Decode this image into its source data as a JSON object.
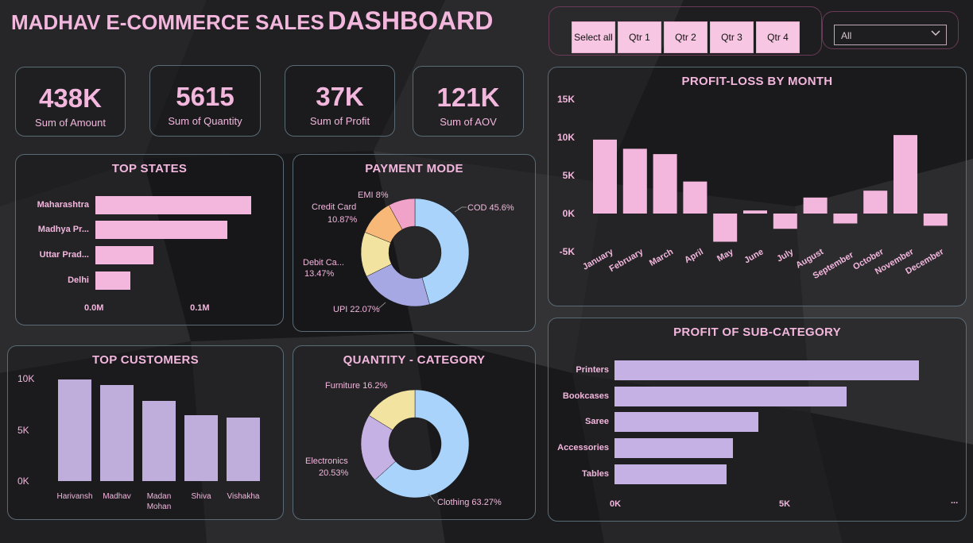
{
  "dashboard": {
    "title_part1": "MADHAV E-COMMERCE SALES",
    "title_part2": "DASHBOARD"
  },
  "slicer": {
    "buttons": [
      "Select all",
      "Qtr 1",
      "Qtr 2",
      "Qtr 3",
      "Qtr 4"
    ],
    "dropdown_value": "All"
  },
  "kpis": [
    {
      "value": "438K",
      "label": "Sum of Amount"
    },
    {
      "value": "5615",
      "label": "Sum of Quantity"
    },
    {
      "value": "37K",
      "label": "Sum of Profit"
    },
    {
      "value": "121K",
      "label": "Sum of AOV"
    }
  ],
  "colors": {
    "pink": "#f3b7de",
    "lavender": "#c6b1e4",
    "blue": "#a9d3fb",
    "yellow": "#f2e3a0",
    "orange": "#f8b878",
    "periwinkle": "#a5a8e2",
    "hotpink": "#f0a2c9"
  },
  "chart_data": [
    {
      "id": "top_states",
      "type": "bar",
      "orientation": "horizontal",
      "title": "TOP STATES",
      "categories": [
        "Maharashtra",
        "Madhya Pr...",
        "Uttar Prad...",
        "Delhi"
      ],
      "values": [
        0.147,
        0.125,
        0.055,
        0.033
      ],
      "x_ticks": [
        "0.0M",
        "0.1M"
      ],
      "xlim": [
        0,
        0.16
      ]
    },
    {
      "id": "payment_mode",
      "type": "pie",
      "donut": true,
      "title": "PAYMENT MODE",
      "labels": [
        "COD",
        "UPI",
        "Debit Ca...",
        "Credit Card",
        "EMI"
      ],
      "values": [
        45.6,
        22.07,
        13.47,
        10.87,
        8
      ],
      "label_texts": [
        "COD 45.6%",
        "UPI 22.07%",
        "Debit Ca... 13.47%",
        "Credit Card 10.87%",
        "EMI 8%"
      ],
      "colors": [
        "#a9d3fb",
        "#a5a8e2",
        "#f2e3a0",
        "#f8b878",
        "#f0a2c9"
      ]
    },
    {
      "id": "top_customers",
      "type": "bar",
      "title": "TOP CUSTOMERS",
      "categories": [
        "Harivansh",
        "Madhav",
        "Madan Mohan",
        "Shiva",
        "Vishakha"
      ],
      "values": [
        9900,
        9400,
        7800,
        6400,
        6200
      ],
      "y_ticks": [
        "10K",
        "5K",
        "0K"
      ],
      "ylim": [
        0,
        10000
      ]
    },
    {
      "id": "quantity_category",
      "type": "pie",
      "donut": true,
      "title": "QUANTITY - CATEGORY",
      "labels": [
        "Clothing",
        "Electronics",
        "Furniture"
      ],
      "values": [
        63.27,
        20.53,
        16.2
      ],
      "label_texts": [
        "Clothing 63.27%",
        "Electronics 20.53%",
        "Furniture 16.2%"
      ],
      "colors": [
        "#a9d3fb",
        "#c6b1e4",
        "#f2e3a0"
      ]
    },
    {
      "id": "profit_loss_month",
      "type": "bar",
      "title": "PROFIT-LOSS BY MONTH",
      "categories": [
        "January",
        "February",
        "March",
        "April",
        "May",
        "June",
        "July",
        "August",
        "September",
        "October",
        "November",
        "December"
      ],
      "values": [
        9700,
        8500,
        7800,
        4200,
        -3700,
        400,
        -2000,
        2100,
        -1300,
        3000,
        10300,
        -1600
      ],
      "y_ticks": [
        "15K",
        "10K",
        "5K",
        "0K",
        "-5K"
      ],
      "ylim": [
        -5000,
        15000
      ]
    },
    {
      "id": "profit_subcategory",
      "type": "bar",
      "orientation": "horizontal",
      "title": "PROFIT OF SUB-CATEGORY",
      "categories": [
        "Printers",
        "Bookcases",
        "Saree",
        "Accessories",
        "Tables"
      ],
      "values": [
        9000,
        6850,
        4250,
        3500,
        3300
      ],
      "x_ticks": [
        "0K",
        "5K"
      ],
      "xlim": [
        0,
        10000
      ],
      "more_indicator": "..."
    }
  ]
}
